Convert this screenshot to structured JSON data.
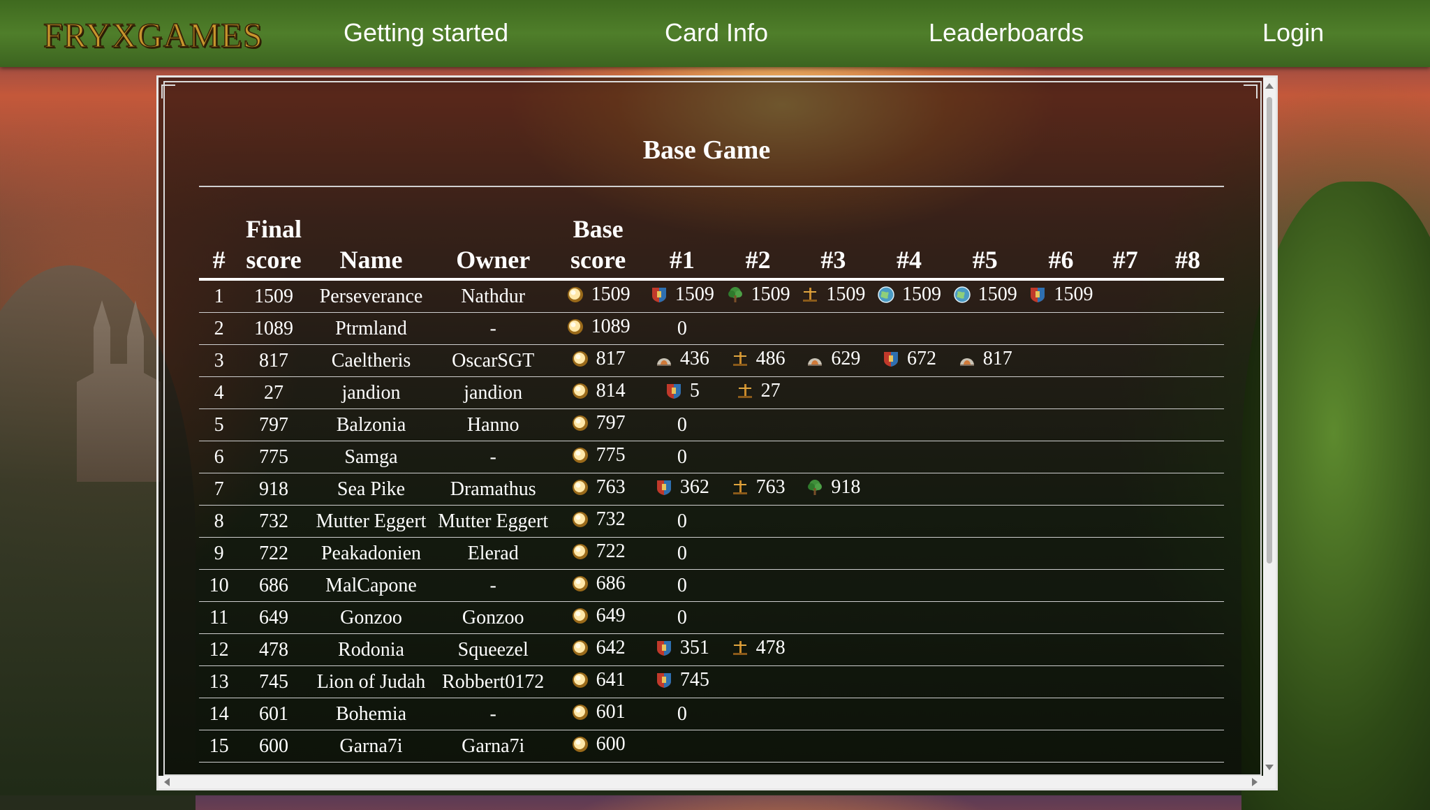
{
  "nav": {
    "logo": "FRYXGAMES",
    "links": [
      "Getting started",
      "Card Info",
      "Leaderboards",
      "Login"
    ]
  },
  "board": {
    "title": "Base Game",
    "headers": [
      "#",
      "Final score",
      "Name",
      "Owner",
      "Base score",
      "#1",
      "#2",
      "#3",
      "#4",
      "#5",
      "#6",
      "#7",
      "#8"
    ],
    "rows": [
      {
        "rank": "1",
        "final": "1509",
        "name": "Perseverance",
        "owner": "Nathdur",
        "base": "1509",
        "gens": [
          [
            "shield-icon",
            "1509"
          ],
          [
            "tree-icon",
            "1509"
          ],
          [
            "scale-icon",
            "1509"
          ],
          [
            "globe-icon",
            "1509"
          ],
          [
            "globe-icon",
            "1509"
          ],
          [
            "shield-icon",
            "1509"
          ]
        ]
      },
      {
        "rank": "2",
        "final": "1089",
        "name": "Ptrmland",
        "owner": "-",
        "base": "1089",
        "gens": [
          [
            null,
            "0"
          ]
        ]
      },
      {
        "rank": "3",
        "final": "817",
        "name": "Caeltheris",
        "owner": "OscarSGT",
        "base": "817",
        "gens": [
          [
            "dome-icon",
            "436"
          ],
          [
            "scale-icon",
            "486"
          ],
          [
            "dome-icon",
            "629"
          ],
          [
            "shield-icon",
            "672"
          ],
          [
            "dome-icon",
            "817"
          ]
        ]
      },
      {
        "rank": "4",
        "final": "27",
        "name": "jandion",
        "owner": "jandion",
        "base": "814",
        "gens": [
          [
            "shield-icon",
            "5"
          ],
          [
            "scale-icon",
            "27"
          ]
        ]
      },
      {
        "rank": "5",
        "final": "797",
        "name": "Balzonia",
        "owner": "Hanno",
        "base": "797",
        "gens": [
          [
            null,
            "0"
          ]
        ]
      },
      {
        "rank": "6",
        "final": "775",
        "name": "Samga",
        "owner": "-",
        "base": "775",
        "gens": [
          [
            null,
            "0"
          ]
        ]
      },
      {
        "rank": "7",
        "final": "918",
        "name": "Sea Pike",
        "owner": "Dramathus",
        "base": "763",
        "gens": [
          [
            "shield-icon",
            "362"
          ],
          [
            "scale-icon",
            "763"
          ],
          [
            "tree-icon",
            "918"
          ]
        ]
      },
      {
        "rank": "8",
        "final": "732",
        "name": "Mutter Eggert",
        "owner": "Mutter Eggert",
        "base": "732",
        "gens": [
          [
            null,
            "0"
          ]
        ]
      },
      {
        "rank": "9",
        "final": "722",
        "name": "Peakadonien",
        "owner": "Elerad",
        "base": "722",
        "gens": [
          [
            null,
            "0"
          ]
        ]
      },
      {
        "rank": "10",
        "final": "686",
        "name": "MalCapone",
        "owner": "-",
        "base": "686",
        "gens": [
          [
            null,
            "0"
          ]
        ]
      },
      {
        "rank": "11",
        "final": "649",
        "name": "Gonzoo",
        "owner": "Gonzoo",
        "base": "649",
        "gens": [
          [
            null,
            "0"
          ]
        ]
      },
      {
        "rank": "12",
        "final": "478",
        "name": "Rodonia",
        "owner": "Squeezel",
        "base": "642",
        "gens": [
          [
            "shield-icon",
            "351"
          ],
          [
            "scale-icon",
            "478"
          ]
        ]
      },
      {
        "rank": "13",
        "final": "745",
        "name": "Lion of Judah",
        "owner": "Robbert0172",
        "base": "641",
        "gens": [
          [
            "shield-icon",
            "745"
          ]
        ]
      },
      {
        "rank": "14",
        "final": "601",
        "name": "Bohemia",
        "owner": "-",
        "base": "601",
        "gens": [
          [
            null,
            "0"
          ]
        ]
      },
      {
        "rank": "15",
        "final": "600",
        "name": "Garna7i",
        "owner": "Garna7i",
        "base": "600",
        "gens": []
      }
    ]
  },
  "colors": {
    "accent_gold": "#c8952d",
    "nav_green": "#4f7e2a"
  }
}
